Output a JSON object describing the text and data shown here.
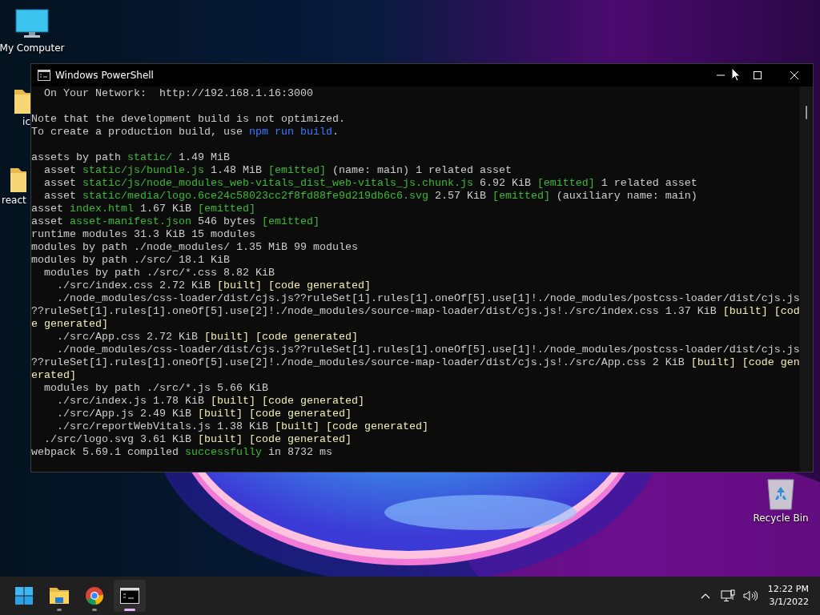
{
  "desktop": {
    "icons": [
      {
        "label": "My Computer",
        "kind": "computer"
      },
      {
        "label": "ic",
        "kind": "folder"
      },
      {
        "label": "react",
        "kind": "folder"
      },
      {
        "label": "Recycle Bin",
        "kind": "recycle-bin"
      }
    ]
  },
  "window": {
    "title": "Windows PowerShell",
    "lines": [
      {
        "kind": "text",
        "segments": [
          {
            "text": "  On Your Network:  http://192.168.1.16:3000",
            "kind": "plain"
          }
        ]
      },
      {
        "kind": "blank"
      },
      {
        "kind": "text",
        "segments": [
          {
            "text": "Note that the development build is not optimized.",
            "kind": "plain"
          }
        ]
      },
      {
        "kind": "text",
        "segments": [
          {
            "text": "To create a production build, use ",
            "kind": "plain"
          },
          {
            "text": "npm run build",
            "kind": "command"
          },
          {
            "text": ".",
            "kind": "plain"
          }
        ]
      },
      {
        "kind": "blank"
      },
      {
        "kind": "text",
        "segments": [
          {
            "text": "assets by path ",
            "kind": "plain"
          },
          {
            "text": "static/",
            "kind": "path"
          },
          {
            "text": " 1.49 MiB",
            "kind": "plain"
          }
        ]
      },
      {
        "kind": "text",
        "segments": [
          {
            "text": "  asset ",
            "kind": "plain"
          },
          {
            "text": "static/js/bundle.js",
            "kind": "path"
          },
          {
            "text": " 1.48 MiB ",
            "kind": "plain"
          },
          {
            "text": "[emitted]",
            "kind": "path"
          },
          {
            "text": " (name: main) 1 related asset",
            "kind": "plain"
          }
        ]
      },
      {
        "kind": "text",
        "segments": [
          {
            "text": "  asset ",
            "kind": "plain"
          },
          {
            "text": "static/js/node_modules_web-vitals_dist_web-vitals_js.chunk.js",
            "kind": "path"
          },
          {
            "text": " 6.92 KiB ",
            "kind": "plain"
          },
          {
            "text": "[emitted]",
            "kind": "path"
          },
          {
            "text": " 1 related asset",
            "kind": "plain"
          }
        ]
      },
      {
        "kind": "text",
        "segments": [
          {
            "text": "  asset ",
            "kind": "plain"
          },
          {
            "text": "static/media/logo.6ce24c58023cc2f8fd88fe9d219db6c6.svg",
            "kind": "path"
          },
          {
            "text": " 2.57 KiB ",
            "kind": "plain"
          },
          {
            "text": "[emitted]",
            "kind": "path"
          },
          {
            "text": " (auxiliary name: main)",
            "kind": "plain"
          }
        ]
      },
      {
        "kind": "text",
        "segments": [
          {
            "text": "asset ",
            "kind": "plain"
          },
          {
            "text": "index.html",
            "kind": "path"
          },
          {
            "text": " 1.67 KiB ",
            "kind": "plain"
          },
          {
            "text": "[emitted]",
            "kind": "path"
          }
        ]
      },
      {
        "kind": "text",
        "segments": [
          {
            "text": "asset ",
            "kind": "plain"
          },
          {
            "text": "asset-manifest.json",
            "kind": "path"
          },
          {
            "text": " 546 bytes ",
            "kind": "plain"
          },
          {
            "text": "[emitted]",
            "kind": "path"
          }
        ]
      },
      {
        "kind": "text",
        "segments": [
          {
            "text": "runtime modules 31.3 KiB 15 modules",
            "kind": "plain"
          }
        ]
      },
      {
        "kind": "text",
        "segments": [
          {
            "text": "modules by path ./node_modules/ 1.35 MiB 99 modules",
            "kind": "plain"
          }
        ]
      },
      {
        "kind": "text",
        "segments": [
          {
            "text": "modules by path ./src/ 18.1 KiB",
            "kind": "plain"
          }
        ]
      },
      {
        "kind": "text",
        "segments": [
          {
            "text": "  modules by path ./src/*.css 8.82 KiB",
            "kind": "plain"
          }
        ]
      },
      {
        "kind": "text",
        "segments": [
          {
            "text": "    ./src/index.css 2.72 KiB ",
            "kind": "plain"
          },
          {
            "text": "[built] [code generated]",
            "kind": "flag"
          }
        ]
      },
      {
        "kind": "text",
        "segments": [
          {
            "text": "    ./node_modules/css-loader/dist/cjs.js??ruleSet[1].rules[1].oneOf[5].use[1]!./node_modules/postcss-loader/dist/cjs.js",
            "kind": "plain"
          }
        ]
      },
      {
        "kind": "text",
        "segments": [
          {
            "text": "??ruleSet[1].rules[1].oneOf[5].use[2]!./node_modules/source-map-loader/dist/cjs.js!./src/index.css 1.37 KiB ",
            "kind": "plain"
          },
          {
            "text": "[built] [cod",
            "kind": "flag"
          }
        ]
      },
      {
        "kind": "text",
        "segments": [
          {
            "text": "e generated]",
            "kind": "flag"
          }
        ]
      },
      {
        "kind": "text",
        "segments": [
          {
            "text": "    ./src/App.css 2.72 KiB ",
            "kind": "plain"
          },
          {
            "text": "[built] [code generated]",
            "kind": "flag"
          }
        ]
      },
      {
        "kind": "text",
        "segments": [
          {
            "text": "    ./node_modules/css-loader/dist/cjs.js??ruleSet[1].rules[1].oneOf[5].use[1]!./node_modules/postcss-loader/dist/cjs.js",
            "kind": "plain"
          }
        ]
      },
      {
        "kind": "text",
        "segments": [
          {
            "text": "??ruleSet[1].rules[1].oneOf[5].use[2]!./node_modules/source-map-loader/dist/cjs.js!./src/App.css 2 KiB ",
            "kind": "plain"
          },
          {
            "text": "[built] [code gen",
            "kind": "flag"
          }
        ]
      },
      {
        "kind": "text",
        "segments": [
          {
            "text": "erated]",
            "kind": "flag"
          }
        ]
      },
      {
        "kind": "text",
        "segments": [
          {
            "text": "  modules by path ./src/*.js 5.66 KiB",
            "kind": "plain"
          }
        ]
      },
      {
        "kind": "text",
        "segments": [
          {
            "text": "    ./src/index.js 1.78 KiB ",
            "kind": "plain"
          },
          {
            "text": "[built] [code generated]",
            "kind": "flag"
          }
        ]
      },
      {
        "kind": "text",
        "segments": [
          {
            "text": "    ./src/App.js 2.49 KiB ",
            "kind": "plain"
          },
          {
            "text": "[built] [code generated]",
            "kind": "flag"
          }
        ]
      },
      {
        "kind": "text",
        "segments": [
          {
            "text": "    ./src/reportWebVitals.js 1.38 KiB ",
            "kind": "plain"
          },
          {
            "text": "[built] [code generated]",
            "kind": "flag"
          }
        ]
      },
      {
        "kind": "text",
        "segments": [
          {
            "text": "  ./src/logo.svg 3.61 KiB ",
            "kind": "plain"
          },
          {
            "text": "[built] [code generated]",
            "kind": "flag"
          }
        ]
      },
      {
        "kind": "text",
        "segments": [
          {
            "text": "webpack 5.69.1 compiled ",
            "kind": "plain"
          },
          {
            "text": "successfully",
            "kind": "path"
          },
          {
            "text": " in 8732 ms",
            "kind": "plain"
          }
        ]
      }
    ]
  },
  "taskbar": {
    "apps": [
      {
        "kind": "start",
        "running": false,
        "selected": false
      },
      {
        "kind": "explorer",
        "running": true,
        "selected": false
      },
      {
        "kind": "browser",
        "running": true,
        "selected": false
      },
      {
        "kind": "console",
        "running": true,
        "selected": true
      }
    ],
    "tray": [
      {
        "kind": "chevron"
      },
      {
        "kind": "network"
      },
      {
        "kind": "volume"
      }
    ],
    "clock": {
      "time": "12:22 PM",
      "date": "3/1/2022"
    }
  }
}
